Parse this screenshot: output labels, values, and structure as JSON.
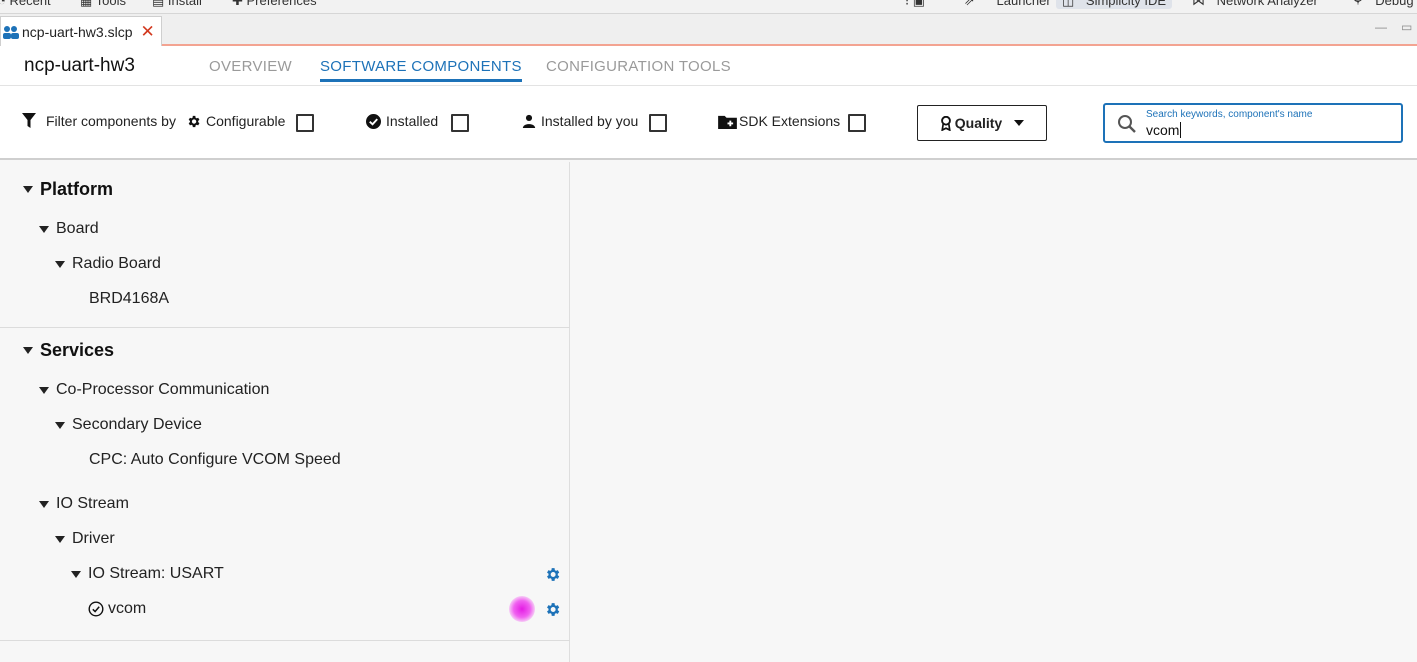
{
  "topbar": {
    "items": [
      "Recent",
      "Tools",
      "Install",
      "Preferences"
    ],
    "perspectives": [
      "Launcher",
      "Simplicity IDE",
      "Network Analyzer",
      "Debug"
    ]
  },
  "editor_tab": {
    "label": "ncp-uart-hw3.slcp",
    "close": "✕"
  },
  "header": {
    "title": "ncp-uart-hw3",
    "tabs": [
      "OVERVIEW",
      "SOFTWARE COMPONENTS",
      "CONFIGURATION TOOLS"
    ],
    "active_tab": "SOFTWARE COMPONENTS"
  },
  "filters": {
    "label": "Filter components by",
    "configurable": "Configurable",
    "installed": "Installed",
    "installed_by_you": "Installed by you",
    "sdk_extensions": "SDK Extensions",
    "quality": "Quality"
  },
  "search": {
    "placeholder": "Search keywords, component's name",
    "value": "vcom"
  },
  "tree": {
    "platform": "Platform",
    "board": "Board",
    "radio_board": "Radio Board",
    "brd": "BRD4168A",
    "services": "Services",
    "coproc": "Co-Processor Communication",
    "secondary": "Secondary Device",
    "cpc": "CPC: Auto Configure VCOM Speed",
    "iostream": "IO Stream",
    "driver": "Driver",
    "usart": "IO Stream: USART",
    "vcom": "vcom"
  },
  "colors": {
    "accent": "#1d72b8",
    "tab_underline": "#f3a391",
    "close": "#d2391f",
    "click_marker": "#e41ce4"
  }
}
